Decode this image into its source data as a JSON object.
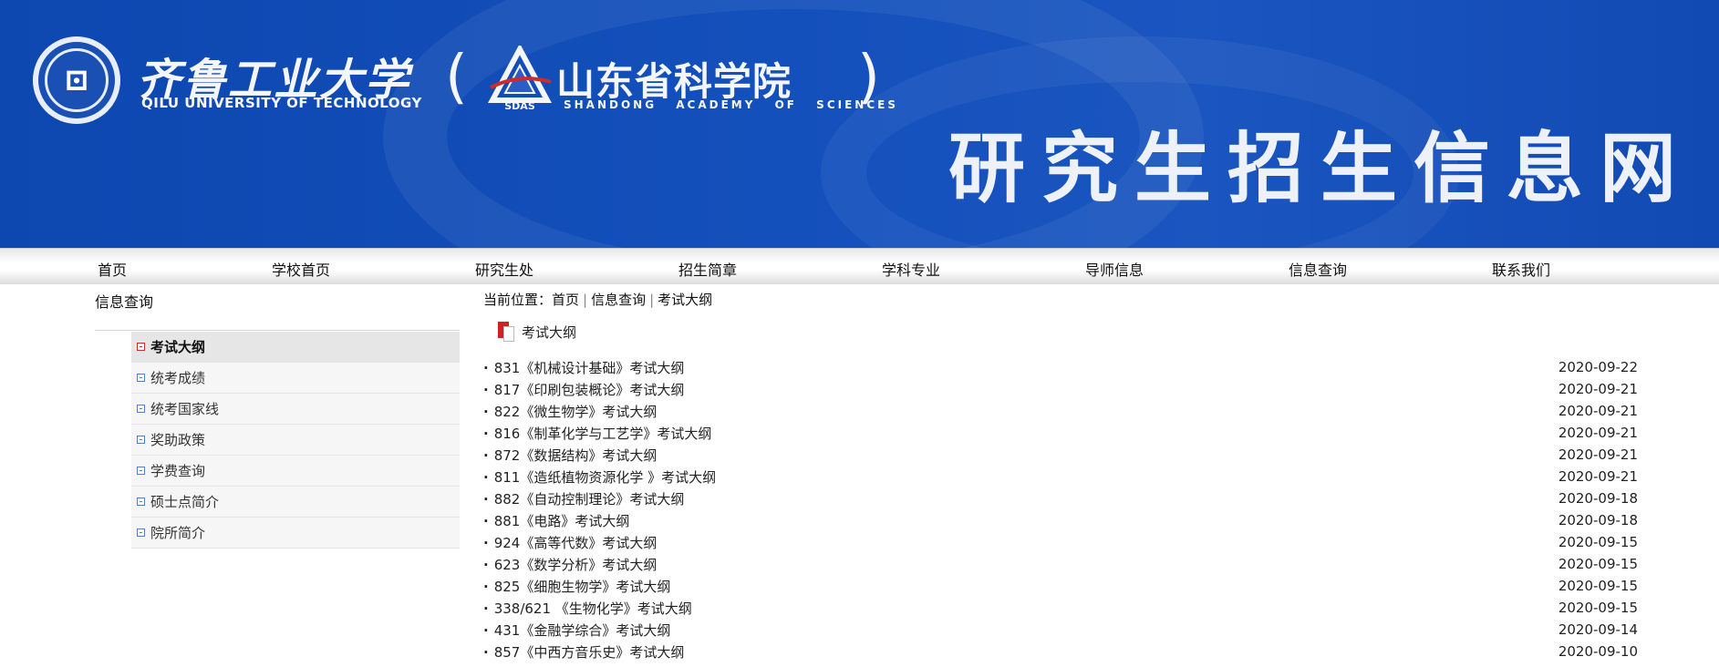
{
  "banner": {
    "university_cn": "齐鲁工业大学",
    "university_en": "QILU UNIVERSITY OF TECHNOLOGY",
    "open_paren": "(",
    "close_paren": ")",
    "academy_cn": "山东省科学院",
    "academy_en": "SHANDONG ACADEMY OF SCIENCES",
    "academy_badge": "SDAS",
    "site_title": "研究生招生信息网",
    "colors": {
      "background": "#1450bb",
      "text": "#f4f6fa"
    }
  },
  "nav": {
    "items": [
      {
        "label": "首页"
      },
      {
        "label": "学校首页"
      },
      {
        "label": "研究生处"
      },
      {
        "label": "招生简章"
      },
      {
        "label": "学科专业"
      },
      {
        "label": "导师信息"
      },
      {
        "label": "信息查询"
      },
      {
        "label": "联系我们"
      }
    ]
  },
  "sidebar": {
    "heading": "信息查询",
    "items": [
      {
        "label": "考试大纲",
        "active": true
      },
      {
        "label": "统考成绩"
      },
      {
        "label": "统考国家线"
      },
      {
        "label": "奖助政策"
      },
      {
        "label": "学费查询"
      },
      {
        "label": "硕士点简介"
      },
      {
        "label": "院所简介"
      }
    ]
  },
  "breadcrumb": {
    "prefix": "当前位置：",
    "items": [
      "首页",
      "信息查询",
      "考试大纲"
    ]
  },
  "section": {
    "title": "考试大纲"
  },
  "list": [
    {
      "title": "831《机械设计基础》考试大纲",
      "date": "2020-09-22"
    },
    {
      "title": "817《印刷包装概论》考试大纲",
      "date": "2020-09-21"
    },
    {
      "title": "822《微生物学》考试大纲",
      "date": "2020-09-21"
    },
    {
      "title": "816《制革化学与工艺学》考试大纲",
      "date": "2020-09-21"
    },
    {
      "title": "872《数据结构》考试大纲",
      "date": "2020-09-21"
    },
    {
      "title": "811《造纸植物资源化学 》考试大纲",
      "date": "2020-09-21"
    },
    {
      "title": "882《自动控制理论》考试大纲",
      "date": "2020-09-18"
    },
    {
      "title": "881《电路》考试大纲",
      "date": "2020-09-18"
    },
    {
      "title": "924《高等代数》考试大纲",
      "date": "2020-09-15"
    },
    {
      "title": "623《数学分析》考试大纲",
      "date": "2020-09-15"
    },
    {
      "title": "825《细胞生物学》考试大纲",
      "date": "2020-09-15"
    },
    {
      "title": "338/621 《生物化学》考试大纲",
      "date": "2020-09-15"
    },
    {
      "title": "431《金融学综合》考试大纲",
      "date": "2020-09-14"
    },
    {
      "title": "857《中西方音乐史》考试大纲",
      "date": "2020-09-10"
    }
  ]
}
